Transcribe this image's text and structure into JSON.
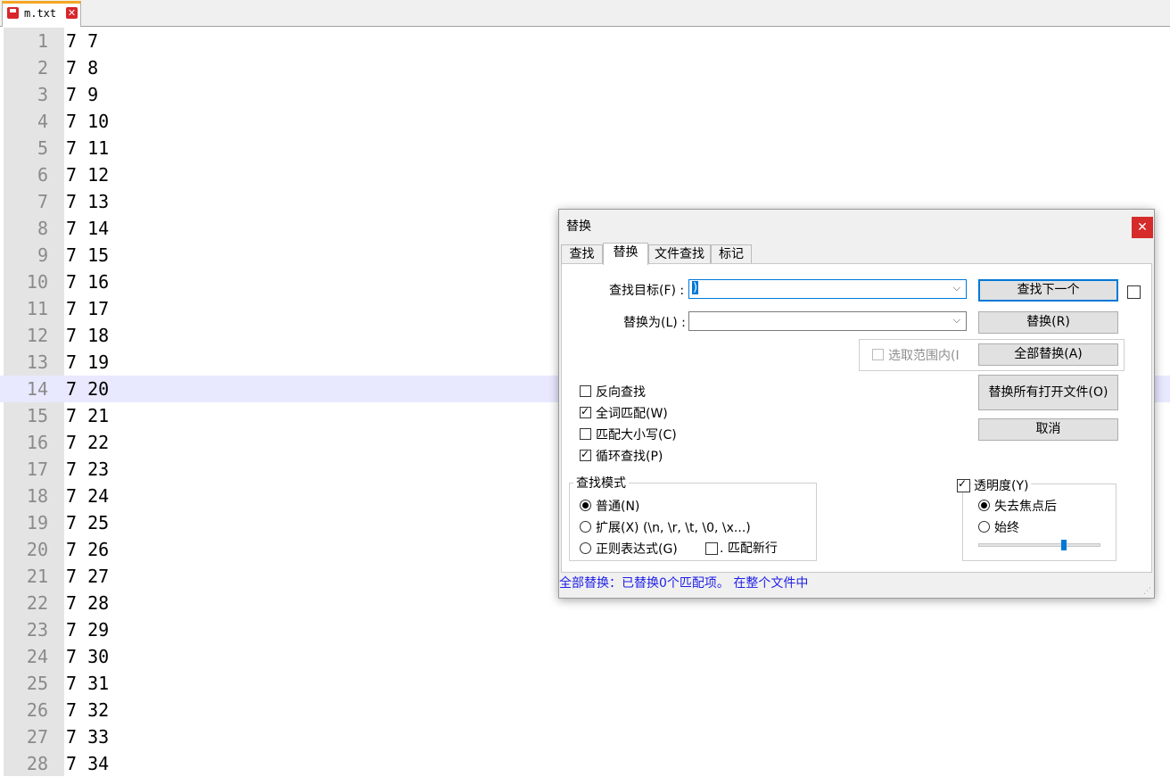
{
  "tab": {
    "filename": "m.txt",
    "close_glyph": "✕",
    "save_icon": "floppy-disk-icon"
  },
  "editor": {
    "current_line": 14,
    "lines": [
      {
        "num": "1",
        "text": "7 7"
      },
      {
        "num": "2",
        "text": "7 8"
      },
      {
        "num": "3",
        "text": "7 9"
      },
      {
        "num": "4",
        "text": "7 10"
      },
      {
        "num": "5",
        "text": "7 11"
      },
      {
        "num": "6",
        "text": "7 12"
      },
      {
        "num": "7",
        "text": "7 13"
      },
      {
        "num": "8",
        "text": "7 14"
      },
      {
        "num": "9",
        "text": "7 15"
      },
      {
        "num": "10",
        "text": "7 16"
      },
      {
        "num": "11",
        "text": "7 17"
      },
      {
        "num": "12",
        "text": "7 18"
      },
      {
        "num": "13",
        "text": "7 19"
      },
      {
        "num": "14",
        "text": "7 20"
      },
      {
        "num": "15",
        "text": "7 21"
      },
      {
        "num": "16",
        "text": "7 22"
      },
      {
        "num": "17",
        "text": "7 23"
      },
      {
        "num": "18",
        "text": "7 24"
      },
      {
        "num": "19",
        "text": "7 25"
      },
      {
        "num": "20",
        "text": "7 26"
      },
      {
        "num": "21",
        "text": "7 27"
      },
      {
        "num": "22",
        "text": "7 28"
      },
      {
        "num": "23",
        "text": "7 29"
      },
      {
        "num": "24",
        "text": "7 30"
      },
      {
        "num": "25",
        "text": "7 31"
      },
      {
        "num": "26",
        "text": "7 32"
      },
      {
        "num": "27",
        "text": "7 33"
      },
      {
        "num": "28",
        "text": "7 34"
      }
    ]
  },
  "dialog": {
    "title": "替换",
    "close_glyph": "✕",
    "tabs": [
      "查找",
      "替换",
      "文件查找",
      "标记"
    ],
    "active_tab": "替换",
    "find_label": "查找目标(F) :",
    "find_value": ")",
    "replace_label": "替换为(L) :",
    "replace_value": "",
    "in_selection": "选取范围内(I",
    "buttons": {
      "find_next": "查找下一个",
      "replace": "替换(R)",
      "replace_all": "全部替换(A)",
      "replace_all_open": "替换所有打开文件(O)",
      "cancel": "取消"
    },
    "options": {
      "backward": "反向查找",
      "whole_word": "全词匹配(W)",
      "match_case": "匹配大小写(C)",
      "wrap": "循环查找(P)"
    },
    "search_mode": {
      "title": "查找模式",
      "normal": "普通(N)",
      "extended": "扩展(X) (\\n, \\r, \\t, \\0, \\x...)",
      "regex": "正则表达式(G)",
      "dot_newline": ". 匹配新行"
    },
    "transparency": {
      "title": "透明度(Y)",
      "on_lose_focus": "失去焦点后",
      "always": "始终",
      "level": 0.7
    },
    "status": "全部替换：已替换0个匹配项。 在整个文件中",
    "status_color": "#1e1ee8"
  }
}
